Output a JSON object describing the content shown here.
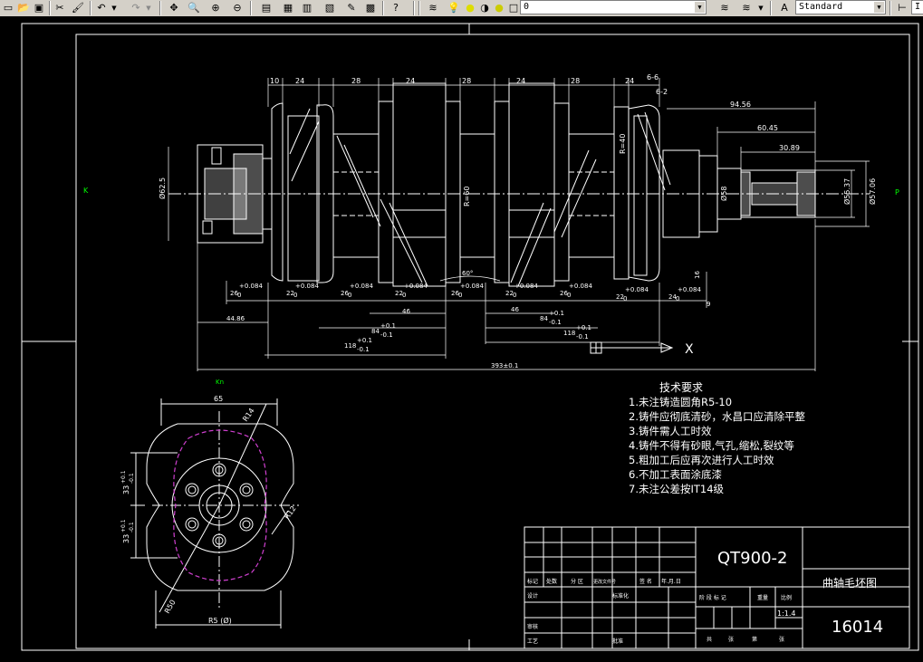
{
  "toolbar": {
    "layer_value": "0",
    "textstyle_value": "Standard",
    "edge_text": "I"
  },
  "viewport": {
    "left_marker": "K",
    "right_marker": "P",
    "section_marker": "Kn",
    "ucs_x": "X"
  },
  "drawing": {
    "top_dims": [
      "10",
      "24",
      "28",
      "24",
      "28",
      "24",
      "28",
      "24"
    ],
    "sec_label_1": "6-6",
    "sec_label_2": "6-2",
    "right_dims": [
      "94.56",
      "60.45",
      "30.89"
    ],
    "dia_left": "Ø62.5",
    "dia_right_1": "Ø55.37",
    "dia_right_2": "Ø57.06",
    "dia_right_3": "Ø58",
    "vert_label_1": "R=60",
    "vert_label_2": "R=40",
    "tol_dims": [
      "26",
      "22",
      "26",
      "22",
      "26",
      "22",
      "26",
      "22",
      "24"
    ],
    "tol_sup": "+0.084",
    "tol_sub": "0",
    "tol_dim_9": "9",
    "tol_dim_16": "16",
    "angle_label": "60°",
    "bottom_dims": {
      "d1": "44.86",
      "d2": "46",
      "d3": "84",
      "d4": "118",
      "d5": "46",
      "d6": "84",
      "d7": "118",
      "overall": "393±0.1",
      "tol": "+0.1",
      "tol_lo": "-0.1"
    },
    "view_dims": {
      "width_top": "65",
      "width_bottom": "R5 (Ø)",
      "height_1": "33",
      "height_2": "33",
      "h_tol": "+0.1",
      "h_tol_lo": "-0.1",
      "r_top": "R14",
      "r_side": "R12",
      "r_bottom": "R50"
    }
  },
  "notes": {
    "title": "技术要求",
    "items": [
      "1.未注铸造圆角R5-10",
      "2.铸件应彻底清砂，水昌口应清除平整",
      "3.铸件需人工时效",
      "4.铸件不得有砂眼,气孔,缩松,裂纹等",
      "5.粗加工后应再次进行人工时效",
      "6.不加工表面涂底漆",
      "7.未注公差按IT14级"
    ]
  },
  "title_block": {
    "material": "QT900-2",
    "part_name": "曲轴毛坯图",
    "drawing_no": "16014",
    "scale": "1:1.4",
    "h_labels": [
      "标记",
      "处数",
      "分 区",
      "更改文件号",
      "签 名",
      "年.月.日"
    ],
    "row_labels": [
      "设计",
      "审核",
      "工艺"
    ],
    "std_label": "标准化",
    "stage_labels": [
      "阶 段 标 记",
      "重量",
      "比例"
    ],
    "sheet_labels": [
      "共",
      "张",
      "第",
      "张"
    ],
    "approve_label": "批准"
  }
}
